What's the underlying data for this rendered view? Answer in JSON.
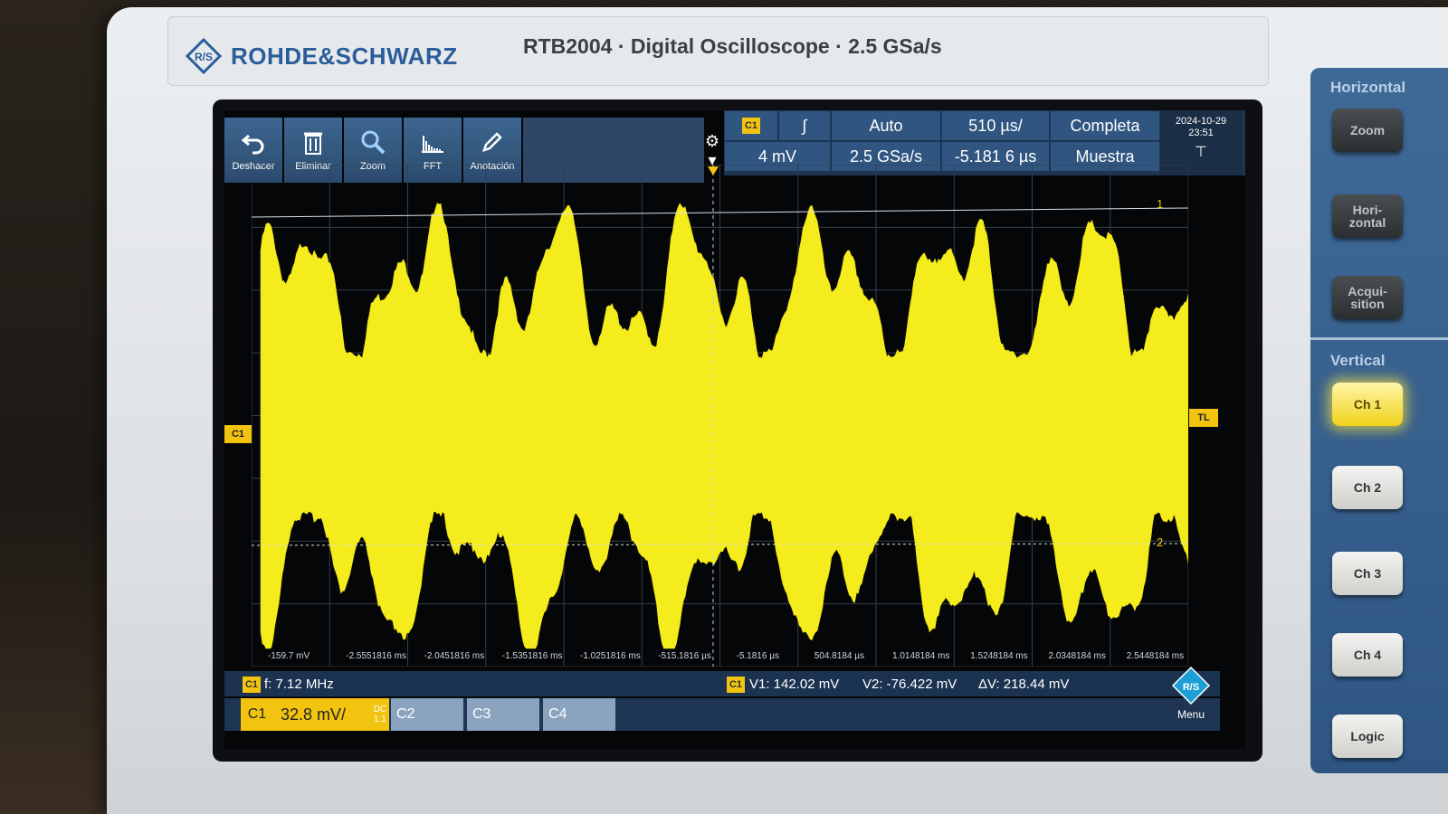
{
  "header": {
    "brand": "ROHDE&SCHWARZ",
    "model": "RTB2004 · Digital Oscilloscope · 2.5 GSa/s"
  },
  "toolbar": {
    "undo": "Deshacer",
    "delete": "Eliminar",
    "zoom": "Zoom",
    "fft": "FFT",
    "annotation": "Anotación"
  },
  "status": {
    "channel_badge": "C1",
    "trigger_slope": "∫",
    "trigger_mode": "Auto",
    "time_per_div": "510 µs/",
    "acq_mode": "Completa",
    "trigger_level": "4 mV",
    "sample_rate": "2.5 GSa/s",
    "offset": "-5.181 6 µs",
    "acq_type": "Muestra",
    "date": "2024-10-29",
    "time": "23:51"
  },
  "plot": {
    "c1_marker": "C1",
    "tl_marker": "TL",
    "cursor1": "1",
    "cursor2": "2",
    "x_tick_labels": [
      "-159.7 mV",
      "-2.5551816 ms",
      "-2.0451816 ms",
      "-1.5351816 ms",
      "-1.0251816 ms",
      "-515.1816 µs",
      "-5.1816 µs",
      "504.8184 µs",
      "1.0148184 ms",
      "1.5248184 ms",
      "2.0348184 ms",
      "2.5448184 ms"
    ]
  },
  "measure": {
    "freq_badge": "C1",
    "freq": "f: 7.12 MHz",
    "cursor_badge": "C1",
    "v1": "V1: 142.02 mV",
    "v2": "V2: -76.422 mV",
    "dv": "ΔV: 218.44 mV"
  },
  "channels": {
    "c1": "C1",
    "c1_scale": "32.8 mV/",
    "c1_coupling": "DC",
    "c1_probe": "1:1",
    "c2": "C2",
    "c3": "C3",
    "c4": "C4",
    "menu": "Menu"
  },
  "panel": {
    "horizontal": "Horizontal",
    "zoom": "Zoom",
    "hori": "Hori-\nzontal",
    "acqu": "Acqui-\nsition",
    "vertical": "Vertical",
    "ch1": "Ch 1",
    "ch2": "Ch 2",
    "ch3": "Ch 3",
    "ch4": "Ch 4",
    "logic": "Logic"
  },
  "colors": {
    "trace": "#f5ec1e",
    "accent": "#2b5d9a",
    "lit": "#f0d21a"
  }
}
